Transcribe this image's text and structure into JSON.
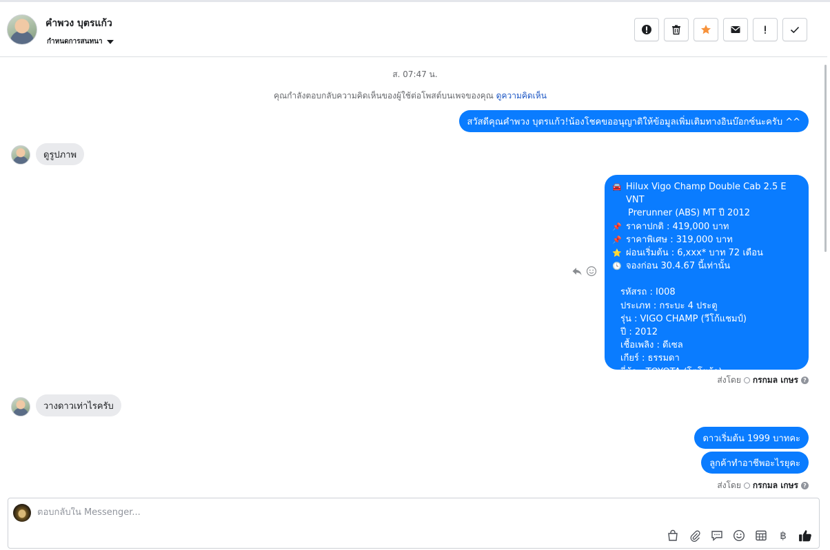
{
  "header": {
    "contact_name": "คำพวง บุตรแก้ว",
    "conversation_settings": "กำหนดการสนทนา",
    "actions": [
      {
        "name": "report-spam-icon",
        "label": "!"
      },
      {
        "name": "trash-icon",
        "label": ""
      },
      {
        "name": "star-icon",
        "label": ""
      },
      {
        "name": "envelope-icon",
        "label": ""
      },
      {
        "name": "exclamation-icon",
        "label": "!"
      },
      {
        "name": "checkmark-icon",
        "label": ""
      }
    ],
    "star_color": "#f7923b"
  },
  "thread": {
    "timestamp": "ส. 07:47 น.",
    "reply_note": "คุณกำลังตอบกลับความคิดเห็นของผู้ใช้ต่อโพสต์บนเพจของคุณ",
    "reply_note_link": "ดูความคิดเห็น",
    "msg_greeting": "สวัสดีคุณคำพวง บุตรแก้ว!น้องโชคขออนุญาติให้ข้อมูลเพิ่มเติมทางอินบ๊อกซ์นะครับ ^^",
    "msg_in_1": "ดูรูปภาพ",
    "card": {
      "title_line1": "Hilux Vigo Champ Double Cab 2.5 E VNT",
      "title_line2": "Prerunner (ABS) MT ปี 2012",
      "price_normal": "ราคาปกติ : 419,000 บาท",
      "price_special": "ราคาพิเศษ : 319,000 บาท",
      "installment": "ผ่อนเริ่มต้น : 6,xxx* บาท 72 เดือน",
      "booking": "จองก่อน 30.4.67 นี้เท่านั้น",
      "code": "รหัสรถ : I008",
      "type": "ประเภท : กระบะ 4 ประตู",
      "model": "รุ่น : VIGO CHAMP (วีโก้แชมป์)",
      "year": "ปี : 2012",
      "fuel": "เชื้อเพลิง : ดีเซล",
      "gear": "เกียร์ : ธรรมดา",
      "brand": "ยี่ห้อ : TOYOTA (โตโยต้า)"
    },
    "sent_by_label": "ส่งโดย",
    "sent_by_name": "กรกมล เกษร",
    "msg_in_2": "วางดาวเท่าไรครับ",
    "msg_out_2": "ดาวเริ่มต้น 1999 บาทคะ",
    "msg_out_3": "ลูกค้าทำอาชีพอะไรยุคะ"
  },
  "composer": {
    "placeholder": "ตอบกลับใน Messenger...",
    "tools": [
      "bag-icon",
      "paperclip-icon",
      "saved-reply-icon",
      "emoji-icon",
      "appointment-icon",
      "baht-icon",
      "thumbs-up-icon"
    ],
    "baht_symbol": "฿"
  },
  "colors": {
    "outgoing_bubble": "#0a7cff",
    "incoming_bubble": "#e9eaed",
    "link": "#1a55c4"
  }
}
